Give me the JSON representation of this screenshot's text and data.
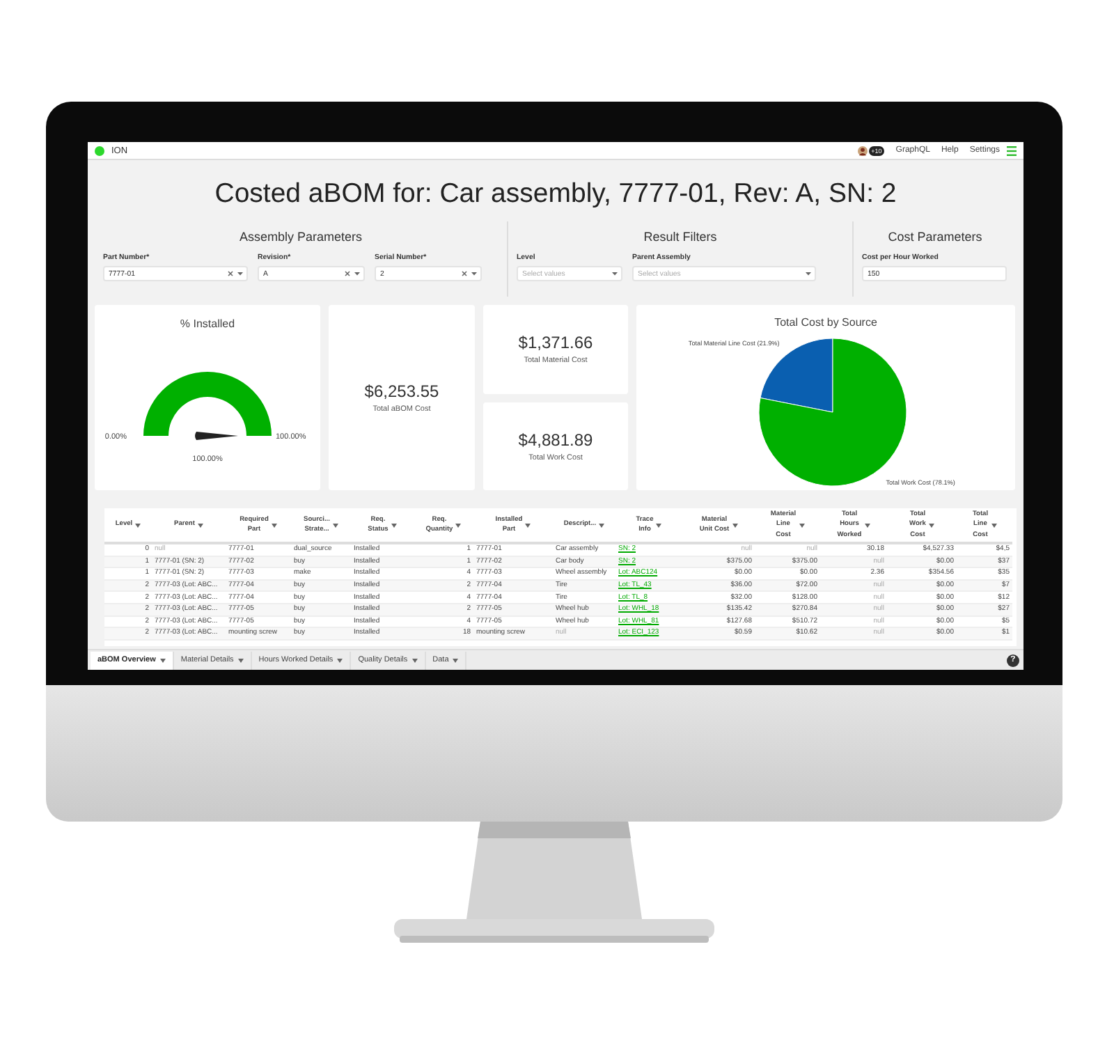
{
  "nav": {
    "logo": "ION",
    "badge": "+10",
    "links": [
      "GraphQL",
      "Help",
      "Settings"
    ]
  },
  "title": "Costed aBOM for: Car assembly, 7777-01, Rev: A, SN: 2",
  "parameter_groups": [
    {
      "title": "Assembly Parameters",
      "fields": [
        {
          "label": "Part Number*",
          "value": "7777-01",
          "kind": "select"
        },
        {
          "label": "Revision*",
          "value": "A",
          "kind": "select"
        },
        {
          "label": "Serial Number*",
          "value": "2",
          "kind": "select"
        }
      ]
    },
    {
      "title": "Result Filters",
      "fields": [
        {
          "label": "Level",
          "placeholder": "Select values",
          "kind": "multiselect"
        },
        {
          "label": "Parent Assembly",
          "placeholder": "Select values",
          "kind": "multiselect"
        }
      ]
    },
    {
      "title": "Cost Parameters",
      "fields": [
        {
          "label": "Cost per Hour Worked",
          "value": "150",
          "kind": "number"
        }
      ]
    }
  ],
  "gauge": {
    "title": "% Installed",
    "level": 1,
    "min_label": "0.00%",
    "max_label": "100.00%",
    "value_label": "100.00%"
  },
  "kpis": [
    {
      "value": "$6,253.55",
      "label": "Total aBOM Cost"
    },
    {
      "value": "$1,371.66",
      "label": "Total Material Cost"
    },
    {
      "value": "$4,881.89",
      "label": "Total Work Cost"
    }
  ],
  "cost_chart": {
    "chart_data": {
      "type": "pie",
      "title": "Total Cost by Source",
      "colors": [
        "#0a5fb0",
        "#00b000"
      ],
      "values": [
        21.9,
        78.1
      ],
      "value_labels": [
        "Total Material Line Cost (21.9%)",
        "Total Work Cost (78.1%)"
      ]
    }
  },
  "table": {
    "columns": [
      {
        "label": "Level",
        "kind": "text"
      },
      {
        "label": "Parent",
        "kind": "text"
      },
      {
        "label": "Required\nPart",
        "kind": "text"
      },
      {
        "label": "Sourci...\nStrate...",
        "kind": "text"
      },
      {
        "label": "Req.\nStatus",
        "kind": "text"
      },
      {
        "label": "Req.\nQuantity",
        "kind": "text"
      },
      {
        "label": "Installed\nPart",
        "kind": "text"
      },
      {
        "label": "Descript...",
        "kind": "text"
      },
      {
        "label": "Trace\nInfo",
        "kind": "link"
      },
      {
        "label": "Material\nUnit Cost",
        "kind": "text"
      },
      {
        "label": "Material\nLine\nCost",
        "kind": "text"
      },
      {
        "label": "Total\nHours\nWorked",
        "kind": "text"
      },
      {
        "label": "Total\nWork\nCost",
        "kind": "text"
      },
      {
        "label": "Total\nLine\nCost",
        "kind": "text"
      }
    ],
    "rows": [
      [
        "0",
        {
          "text": "null",
          "muted": true
        },
        "7777-01",
        "dual_source",
        "Installed",
        "1",
        "7777-01",
        "Car assembly",
        "SN: 2",
        {
          "text": "null",
          "muted": true
        },
        {
          "text": "null",
          "muted": true
        },
        "30.18",
        "$4,527.33",
        "$4,5"
      ],
      [
        "1",
        "7777-01 (SN: 2)",
        "7777-02",
        "buy",
        "Installed",
        "1",
        "7777-02",
        "Car body",
        "SN: 2",
        "$375.00",
        "$375.00",
        {
          "text": "null",
          "muted": true
        },
        "$0.00",
        "$37"
      ],
      [
        "1",
        "7777-01 (SN: 2)",
        "7777-03",
        "make",
        "Installed",
        "4",
        "7777-03",
        "Wheel assembly",
        "Lot: ABC124",
        "$0.00",
        "$0.00",
        "2.36",
        "$354.56",
        "$35"
      ],
      [
        "2",
        "7777-03 (Lot: ABC...",
        "7777-04",
        "buy",
        "Installed",
        "2",
        "7777-04",
        "Tire",
        "Lot: TL_43",
        "$36.00",
        "$72.00",
        {
          "text": "null",
          "muted": true
        },
        "$0.00",
        "$7"
      ],
      [
        "2",
        "7777-03 (Lot: ABC...",
        "7777-04",
        "buy",
        "Installed",
        "4",
        "7777-04",
        "Tire",
        "Lot: TL_8",
        "$32.00",
        "$128.00",
        {
          "text": "null",
          "muted": true
        },
        "$0.00",
        "$12"
      ],
      [
        "2",
        "7777-03 (Lot: ABC...",
        "7777-05",
        "buy",
        "Installed",
        "2",
        "7777-05",
        "Wheel hub",
        "Lot: WHL_18",
        "$135.42",
        "$270.84",
        {
          "text": "null",
          "muted": true
        },
        "$0.00",
        "$27"
      ],
      [
        "2",
        "7777-03 (Lot: ABC...",
        "7777-05",
        "buy",
        "Installed",
        "4",
        "7777-05",
        "Wheel hub",
        "Lot: WHL_81",
        "$127.68",
        "$510.72",
        {
          "text": "null",
          "muted": true
        },
        "$0.00",
        "$5"
      ],
      [
        "2",
        "7777-03 (Lot: ABC...",
        "mounting screw",
        "buy",
        "Installed",
        "18",
        "mounting screw",
        {
          "text": "null",
          "muted": true
        },
        "Lot: ECI_123",
        "$0.59",
        "$10.62",
        {
          "text": "null",
          "muted": true
        },
        "$0.00",
        "$1"
      ]
    ]
  },
  "tabs": [
    {
      "label": "aBOM Overview",
      "selected": true
    },
    {
      "label": "Material Details",
      "selected": false
    },
    {
      "label": "Hours Worked Details",
      "selected": false
    },
    {
      "label": "Quality Details",
      "selected": false
    },
    {
      "label": "Data",
      "selected": false
    }
  ],
  "help_button": "?"
}
